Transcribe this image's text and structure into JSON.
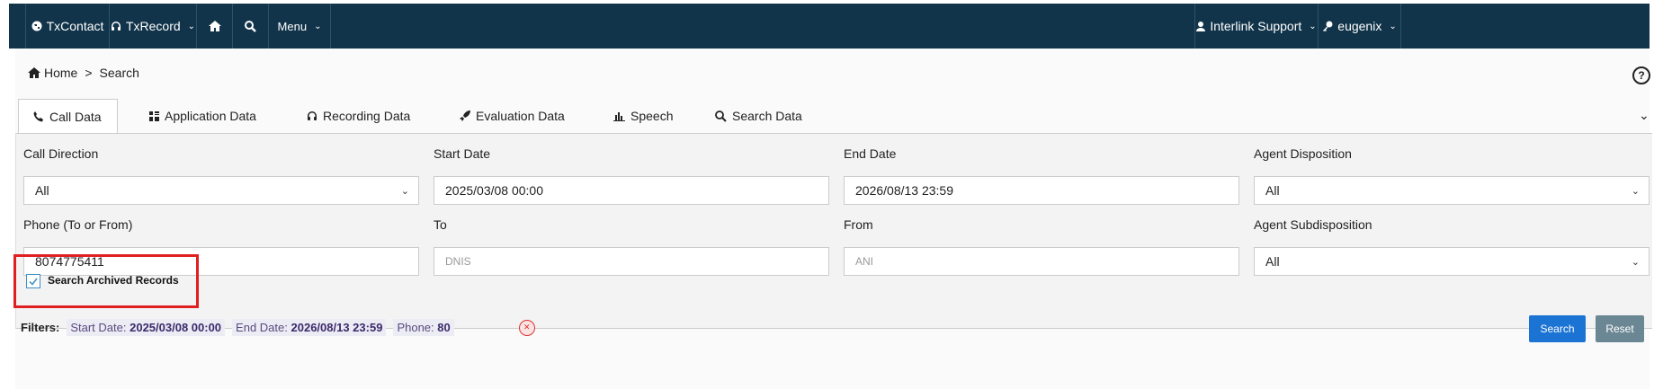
{
  "navbar": {
    "items": [
      {
        "label": "TxContact",
        "icon": "globe-icon"
      },
      {
        "label": "TxRecord",
        "icon": "headphones-icon",
        "dropdown": true
      },
      {
        "label": "",
        "icon": "home-icon"
      },
      {
        "label": "",
        "icon": "search-icon"
      },
      {
        "label": "Menu",
        "dropdown": true
      }
    ],
    "right": [
      {
        "label": "Interlink Support",
        "icon": "user-icon",
        "dropdown": true
      },
      {
        "label": "eugenix",
        "icon": "key-icon",
        "dropdown": true
      }
    ]
  },
  "breadcrumb": {
    "home": "Home",
    "separator": ">",
    "current": "Search"
  },
  "tabs": [
    {
      "label": "Call Data",
      "icon": "phone-icon",
      "active": true
    },
    {
      "label": "Application Data",
      "icon": "grid-icon"
    },
    {
      "label": "Recording Data",
      "icon": "headphones-icon"
    },
    {
      "label": "Evaluation Data",
      "icon": "rocket-icon"
    },
    {
      "label": "Speech",
      "icon": "bar-chart-icon"
    },
    {
      "label": "Search Data",
      "icon": "search-icon"
    }
  ],
  "form": {
    "call_direction": {
      "label": "Call Direction",
      "value": "All"
    },
    "start_date": {
      "label": "Start Date",
      "value": "2025/03/08 00:00"
    },
    "end_date": {
      "label": "End Date",
      "value": "2026/08/13 23:59"
    },
    "agent_disposition": {
      "label": "Agent Disposition",
      "value": "All"
    },
    "phone": {
      "label": "Phone (To or From)",
      "value": "8074775411"
    },
    "to": {
      "label": "To",
      "placeholder": "DNIS"
    },
    "from": {
      "label": "From",
      "placeholder": "ANI"
    },
    "agent_subdisposition": {
      "label": "Agent Subdisposition",
      "value": "All"
    },
    "archived": {
      "label": "Search Archived Records",
      "checked": true
    }
  },
  "filters": {
    "title": "Filters:",
    "start_label": "Start Date:",
    "start_value": "2025/03/08 00:00",
    "end_label": "End Date:",
    "end_value": "2026/08/13 23:59",
    "phone_label": "Phone:",
    "phone_value": "80"
  },
  "buttons": {
    "search": "Search",
    "reset": "Reset"
  },
  "colors": {
    "navbar": "#11344a",
    "search_button": "#1b73d3",
    "reset_button": "#6c8794",
    "highlight": "#e02020"
  }
}
